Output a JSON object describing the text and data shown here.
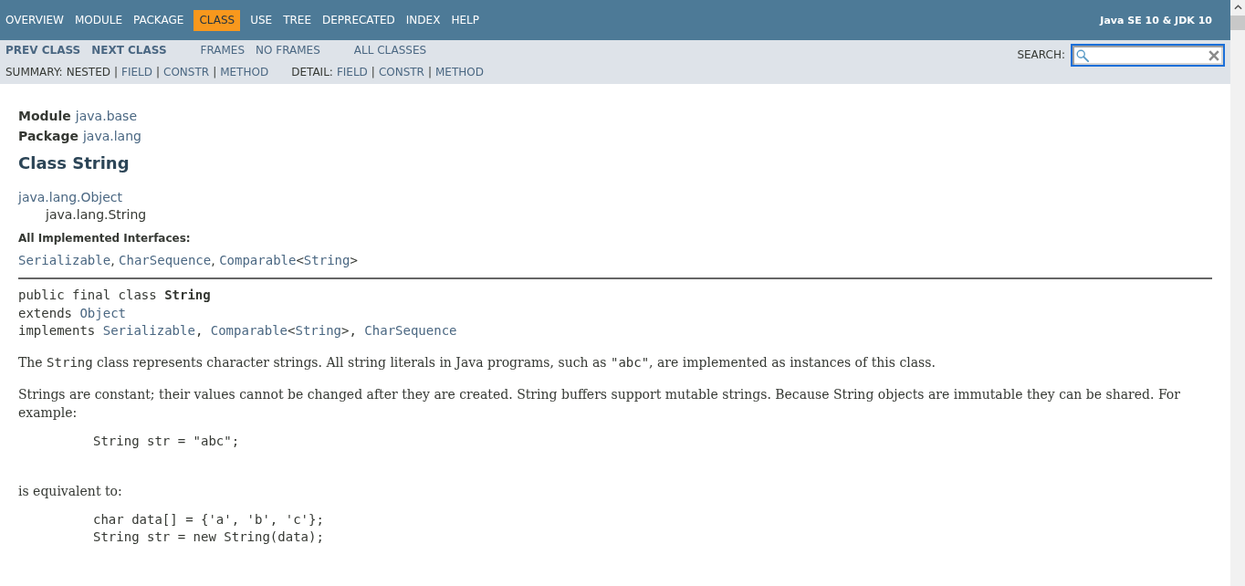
{
  "top_nav": {
    "items": [
      {
        "label": "OVERVIEW",
        "selected": false
      },
      {
        "label": "MODULE",
        "selected": false
      },
      {
        "label": "PACKAGE",
        "selected": false
      },
      {
        "label": "CLASS",
        "selected": true
      },
      {
        "label": "USE",
        "selected": false
      },
      {
        "label": "TREE",
        "selected": false
      },
      {
        "label": "DEPRECATED",
        "selected": false
      },
      {
        "label": "INDEX",
        "selected": false
      },
      {
        "label": "HELP",
        "selected": false
      }
    ],
    "title": "Java SE 10 & JDK 10"
  },
  "sub_nav": {
    "groups": [
      [
        {
          "label": "PREV CLASS",
          "kind": "strong"
        },
        {
          "label": "NEXT CLASS",
          "kind": "strong"
        }
      ],
      [
        {
          "label": "FRAMES",
          "kind": "plain"
        },
        {
          "label": "NO FRAMES",
          "kind": "plain"
        }
      ],
      [
        {
          "label": "ALL CLASSES",
          "kind": "plain"
        }
      ]
    ],
    "summary_rows": [
      [
        {
          "kind": "label",
          "text": "SUMMARY:"
        },
        {
          "kind": "text",
          "text": "NESTED"
        },
        {
          "kind": "separator",
          "text": "|"
        },
        {
          "kind": "link",
          "text": "FIELD"
        },
        {
          "kind": "separator",
          "text": "|"
        },
        {
          "kind": "link",
          "text": "CONSTR"
        },
        {
          "kind": "separator",
          "text": "|"
        },
        {
          "kind": "link",
          "text": "METHOD"
        }
      ],
      [
        {
          "kind": "label",
          "text": "DETAIL:"
        },
        {
          "kind": "link",
          "text": "FIELD"
        },
        {
          "kind": "separator",
          "text": "|"
        },
        {
          "kind": "link",
          "text": "CONSTR"
        },
        {
          "kind": "separator",
          "text": "|"
        },
        {
          "kind": "link",
          "text": "METHOD"
        }
      ]
    ]
  },
  "search": {
    "label": "SEARCH:",
    "focused": true
  },
  "header": {
    "module": {
      "label": "Module",
      "value": "java.base"
    },
    "package": {
      "label": "Package",
      "value": "java.lang"
    },
    "title": "Class String"
  },
  "inheritance": [
    {
      "label": "java.lang.Object",
      "link": true,
      "children": [
        {
          "label": "java.lang.String",
          "link": false
        }
      ]
    }
  ],
  "interfaces": {
    "label": "All Implemented Interfaces:",
    "segments": [
      {
        "kind": "link",
        "text": "Serializable"
      },
      {
        "kind": "text",
        "text": ", "
      },
      {
        "kind": "link",
        "text": "CharSequence"
      },
      {
        "kind": "text",
        "text": ", "
      },
      {
        "kind": "link",
        "text": "Comparable"
      },
      {
        "kind": "code",
        "text": "<"
      },
      {
        "kind": "link",
        "text": "String"
      },
      {
        "kind": "code",
        "text": ">"
      }
    ]
  },
  "signature": [
    [
      {
        "kind": "text",
        "text": "public final class **String**"
      }
    ],
    [
      {
        "kind": "text",
        "text": "extends "
      },
      {
        "kind": "link",
        "text": "Object"
      }
    ],
    [
      {
        "kind": "text",
        "text": "implements "
      },
      {
        "kind": "link",
        "text": "Serializable"
      },
      {
        "kind": "text",
        "text": ", "
      },
      {
        "kind": "link",
        "text": "Comparable"
      },
      {
        "kind": "text",
        "text": "<"
      },
      {
        "kind": "link",
        "text": "String"
      },
      {
        "kind": "text",
        "text": ">, "
      },
      {
        "kind": "link",
        "text": "CharSequence"
      }
    ]
  ],
  "description": [
    {
      "kind": "paragraph",
      "segments": [
        {
          "kind": "text",
          "text": "The "
        },
        {
          "kind": "code",
          "text": "String"
        },
        {
          "kind": "text",
          "text": " class represents character strings. All string literals in Java programs, such as "
        },
        {
          "kind": "code",
          "text": "\"abc\""
        },
        {
          "kind": "text",
          "text": ", are implemented as instances of this class."
        }
      ]
    },
    {
      "kind": "paragraph",
      "segments": [
        {
          "kind": "text",
          "text": "Strings are constant; their values cannot be changed after they are created. String buffers support mutable strings. Because String objects are immutable they can be shared. For example:"
        }
      ]
    },
    {
      "kind": "code",
      "lines": [
        "String str = \"abc\";"
      ]
    },
    {
      "kind": "paragraph",
      "segments": [
        {
          "kind": "text",
          "text": "is equivalent to:"
        }
      ]
    },
    {
      "kind": "code",
      "lines": [
        "char data[] = {'a', 'b', 'c'};",
        "String str = new String(data);"
      ]
    }
  ]
}
